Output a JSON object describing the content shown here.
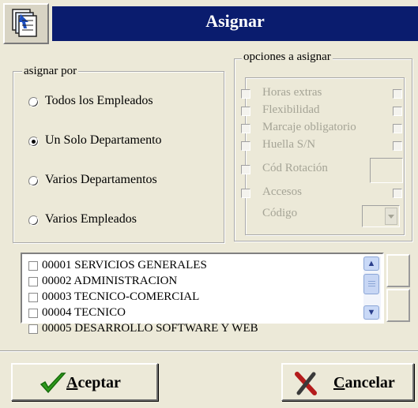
{
  "window": {
    "title": "Asignar"
  },
  "asignar_por": {
    "legend": "asignar por",
    "options": [
      {
        "label": "Todos los Empleados",
        "selected": false
      },
      {
        "label": "Un Solo Departamento",
        "selected": true
      },
      {
        "label": "Varios Departamentos",
        "selected": false
      },
      {
        "label": "Varios Empleados",
        "selected": false
      }
    ]
  },
  "opciones": {
    "legend": "opciones a asignar",
    "items": [
      {
        "label": "Horas extras"
      },
      {
        "label": "Flexibilidad"
      },
      {
        "label": "Marcaje obligatorio"
      },
      {
        "label": "Huella S/N"
      },
      {
        "label": "Cód Rotación"
      },
      {
        "label": "Accesos"
      }
    ],
    "codigo_label": "Código",
    "codigo_dropdown_icon": "chevron-down-icon"
  },
  "departments": [
    {
      "label": "00001 SERVICIOS GENERALES"
    },
    {
      "label": "00002 ADMINISTRACION"
    },
    {
      "label": "00003 TECNICO-COMERCIAL"
    },
    {
      "label": "00004 TECNICO"
    },
    {
      "label": "00005 DESARROLLO SOFTWARE Y WEB"
    }
  ],
  "buttons": {
    "accept": {
      "mnemonic": "A",
      "rest": "ceptar",
      "icon": "checkmark-icon",
      "color": "#2e9a1c"
    },
    "cancel": {
      "mnemonic": "C",
      "rest": "ancelar",
      "icon": "x-icon",
      "color": "#b41c1c"
    }
  },
  "colors": {
    "title_bar": "#0a1c6e",
    "face": "#ece9d8",
    "disabled_text": "#a5a496"
  }
}
